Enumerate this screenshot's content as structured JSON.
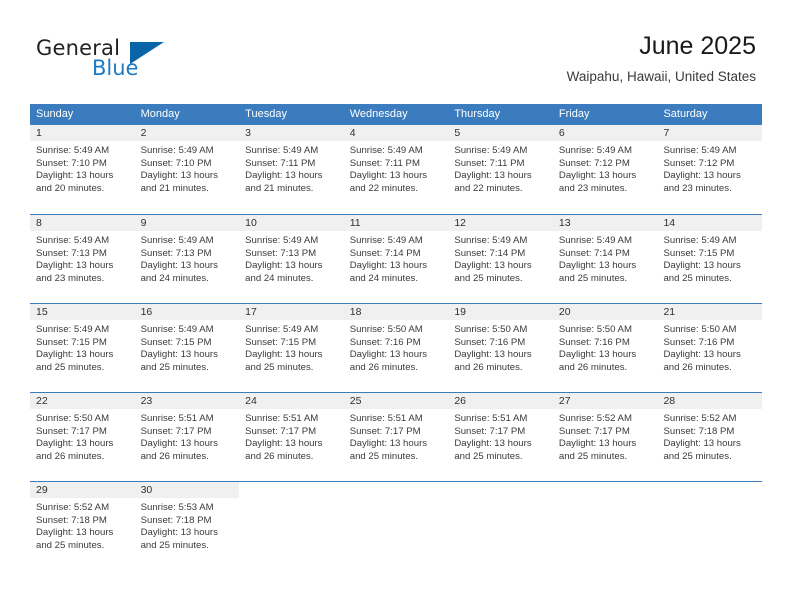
{
  "brand": {
    "word1": "General",
    "word2": "Blue",
    "triangle_color": "#0a64a8",
    "blue_color": "#1f7ac4"
  },
  "header": {
    "title": "June 2025",
    "location": "Waipahu, Hawaii, United States"
  },
  "theme": {
    "header_bg": "#3a7cbe",
    "daynum_bg": "#f0f0f0",
    "rule_color": "#3a7cbe"
  },
  "weekdays": [
    "Sunday",
    "Monday",
    "Tuesday",
    "Wednesday",
    "Thursday",
    "Friday",
    "Saturday"
  ],
  "weeks": [
    [
      {
        "day": "1",
        "sunrise": "Sunrise: 5:49 AM",
        "sunset": "Sunset: 7:10 PM",
        "daylight1": "Daylight: 13 hours",
        "daylight2": "and 20 minutes."
      },
      {
        "day": "2",
        "sunrise": "Sunrise: 5:49 AM",
        "sunset": "Sunset: 7:10 PM",
        "daylight1": "Daylight: 13 hours",
        "daylight2": "and 21 minutes."
      },
      {
        "day": "3",
        "sunrise": "Sunrise: 5:49 AM",
        "sunset": "Sunset: 7:11 PM",
        "daylight1": "Daylight: 13 hours",
        "daylight2": "and 21 minutes."
      },
      {
        "day": "4",
        "sunrise": "Sunrise: 5:49 AM",
        "sunset": "Sunset: 7:11 PM",
        "daylight1": "Daylight: 13 hours",
        "daylight2": "and 22 minutes."
      },
      {
        "day": "5",
        "sunrise": "Sunrise: 5:49 AM",
        "sunset": "Sunset: 7:11 PM",
        "daylight1": "Daylight: 13 hours",
        "daylight2": "and 22 minutes."
      },
      {
        "day": "6",
        "sunrise": "Sunrise: 5:49 AM",
        "sunset": "Sunset: 7:12 PM",
        "daylight1": "Daylight: 13 hours",
        "daylight2": "and 23 minutes."
      },
      {
        "day": "7",
        "sunrise": "Sunrise: 5:49 AM",
        "sunset": "Sunset: 7:12 PM",
        "daylight1": "Daylight: 13 hours",
        "daylight2": "and 23 minutes."
      }
    ],
    [
      {
        "day": "8",
        "sunrise": "Sunrise: 5:49 AM",
        "sunset": "Sunset: 7:13 PM",
        "daylight1": "Daylight: 13 hours",
        "daylight2": "and 23 minutes."
      },
      {
        "day": "9",
        "sunrise": "Sunrise: 5:49 AM",
        "sunset": "Sunset: 7:13 PM",
        "daylight1": "Daylight: 13 hours",
        "daylight2": "and 24 minutes."
      },
      {
        "day": "10",
        "sunrise": "Sunrise: 5:49 AM",
        "sunset": "Sunset: 7:13 PM",
        "daylight1": "Daylight: 13 hours",
        "daylight2": "and 24 minutes."
      },
      {
        "day": "11",
        "sunrise": "Sunrise: 5:49 AM",
        "sunset": "Sunset: 7:14 PM",
        "daylight1": "Daylight: 13 hours",
        "daylight2": "and 24 minutes."
      },
      {
        "day": "12",
        "sunrise": "Sunrise: 5:49 AM",
        "sunset": "Sunset: 7:14 PM",
        "daylight1": "Daylight: 13 hours",
        "daylight2": "and 25 minutes."
      },
      {
        "day": "13",
        "sunrise": "Sunrise: 5:49 AM",
        "sunset": "Sunset: 7:14 PM",
        "daylight1": "Daylight: 13 hours",
        "daylight2": "and 25 minutes."
      },
      {
        "day": "14",
        "sunrise": "Sunrise: 5:49 AM",
        "sunset": "Sunset: 7:15 PM",
        "daylight1": "Daylight: 13 hours",
        "daylight2": "and 25 minutes."
      }
    ],
    [
      {
        "day": "15",
        "sunrise": "Sunrise: 5:49 AM",
        "sunset": "Sunset: 7:15 PM",
        "daylight1": "Daylight: 13 hours",
        "daylight2": "and 25 minutes."
      },
      {
        "day": "16",
        "sunrise": "Sunrise: 5:49 AM",
        "sunset": "Sunset: 7:15 PM",
        "daylight1": "Daylight: 13 hours",
        "daylight2": "and 25 minutes."
      },
      {
        "day": "17",
        "sunrise": "Sunrise: 5:49 AM",
        "sunset": "Sunset: 7:15 PM",
        "daylight1": "Daylight: 13 hours",
        "daylight2": "and 25 minutes."
      },
      {
        "day": "18",
        "sunrise": "Sunrise: 5:50 AM",
        "sunset": "Sunset: 7:16 PM",
        "daylight1": "Daylight: 13 hours",
        "daylight2": "and 26 minutes."
      },
      {
        "day": "19",
        "sunrise": "Sunrise: 5:50 AM",
        "sunset": "Sunset: 7:16 PM",
        "daylight1": "Daylight: 13 hours",
        "daylight2": "and 26 minutes."
      },
      {
        "day": "20",
        "sunrise": "Sunrise: 5:50 AM",
        "sunset": "Sunset: 7:16 PM",
        "daylight1": "Daylight: 13 hours",
        "daylight2": "and 26 minutes."
      },
      {
        "day": "21",
        "sunrise": "Sunrise: 5:50 AM",
        "sunset": "Sunset: 7:16 PM",
        "daylight1": "Daylight: 13 hours",
        "daylight2": "and 26 minutes."
      }
    ],
    [
      {
        "day": "22",
        "sunrise": "Sunrise: 5:50 AM",
        "sunset": "Sunset: 7:17 PM",
        "daylight1": "Daylight: 13 hours",
        "daylight2": "and 26 minutes."
      },
      {
        "day": "23",
        "sunrise": "Sunrise: 5:51 AM",
        "sunset": "Sunset: 7:17 PM",
        "daylight1": "Daylight: 13 hours",
        "daylight2": "and 26 minutes."
      },
      {
        "day": "24",
        "sunrise": "Sunrise: 5:51 AM",
        "sunset": "Sunset: 7:17 PM",
        "daylight1": "Daylight: 13 hours",
        "daylight2": "and 26 minutes."
      },
      {
        "day": "25",
        "sunrise": "Sunrise: 5:51 AM",
        "sunset": "Sunset: 7:17 PM",
        "daylight1": "Daylight: 13 hours",
        "daylight2": "and 25 minutes."
      },
      {
        "day": "26",
        "sunrise": "Sunrise: 5:51 AM",
        "sunset": "Sunset: 7:17 PM",
        "daylight1": "Daylight: 13 hours",
        "daylight2": "and 25 minutes."
      },
      {
        "day": "27",
        "sunrise": "Sunrise: 5:52 AM",
        "sunset": "Sunset: 7:17 PM",
        "daylight1": "Daylight: 13 hours",
        "daylight2": "and 25 minutes."
      },
      {
        "day": "28",
        "sunrise": "Sunrise: 5:52 AM",
        "sunset": "Sunset: 7:18 PM",
        "daylight1": "Daylight: 13 hours",
        "daylight2": "and 25 minutes."
      }
    ],
    [
      {
        "day": "29",
        "sunrise": "Sunrise: 5:52 AM",
        "sunset": "Sunset: 7:18 PM",
        "daylight1": "Daylight: 13 hours",
        "daylight2": "and 25 minutes."
      },
      {
        "day": "30",
        "sunrise": "Sunrise: 5:53 AM",
        "sunset": "Sunset: 7:18 PM",
        "daylight1": "Daylight: 13 hours",
        "daylight2": "and 25 minutes."
      },
      {
        "day": "",
        "sunrise": "",
        "sunset": "",
        "daylight1": "",
        "daylight2": ""
      },
      {
        "day": "",
        "sunrise": "",
        "sunset": "",
        "daylight1": "",
        "daylight2": ""
      },
      {
        "day": "",
        "sunrise": "",
        "sunset": "",
        "daylight1": "",
        "daylight2": ""
      },
      {
        "day": "",
        "sunrise": "",
        "sunset": "",
        "daylight1": "",
        "daylight2": ""
      },
      {
        "day": "",
        "sunrise": "",
        "sunset": "",
        "daylight1": "",
        "daylight2": ""
      }
    ]
  ]
}
